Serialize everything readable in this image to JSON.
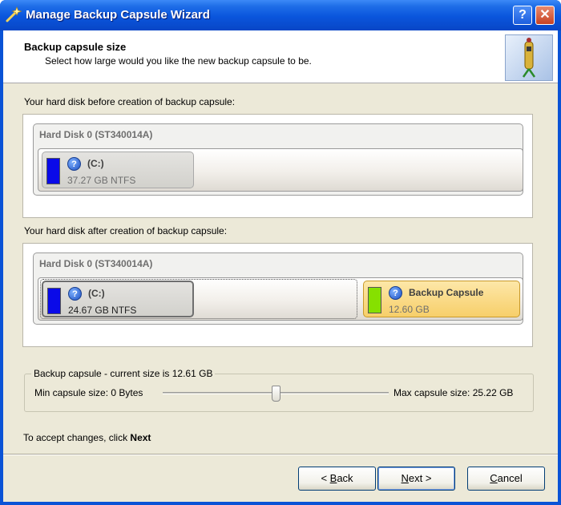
{
  "window": {
    "title": "Manage Backup Capsule Wizard",
    "help_glyph": "?",
    "close_glyph": "✕"
  },
  "header": {
    "title": "Backup capsule size",
    "subtitle": "Select how large would you like the new backup capsule to be."
  },
  "before": {
    "label": "Your hard disk before creation of backup capsule:",
    "disk_title": "Hard Disk 0 (ST340014A)",
    "partitions": [
      {
        "name": "(C:)",
        "size": "37.27 GB NTFS",
        "color": "#0a0ae8"
      }
    ]
  },
  "after": {
    "label": "Your hard disk after creation of backup capsule:",
    "disk_title": "Hard Disk 0 (ST340014A)",
    "partitions": [
      {
        "name": "(C:)",
        "size": "24.67 GB NTFS",
        "color": "#0a0ae8"
      },
      {
        "name": "Backup Capsule",
        "size": "12.60 GB",
        "color": "#86e000"
      }
    ]
  },
  "capsule": {
    "legend": "Backup capsule - current size is 12.61 GB",
    "min_label": "Min capsule size:",
    "min_value": "0 Bytes",
    "max_label": "Max capsule size:",
    "max_value": "25.22 GB",
    "slider_fraction": 0.5
  },
  "footer": {
    "accept_prefix": "To accept changes, click ",
    "accept_bold": "Next"
  },
  "buttons": {
    "back_mnemonic": "B",
    "back_rest": "ack",
    "back_arrow": "< ",
    "next_mnemonic": "N",
    "next_rest": "ext",
    "next_arrow": " >",
    "cancel_mnemonic": "C",
    "cancel_rest": "ancel"
  },
  "icons": {
    "partition_icon": "help-question-icon",
    "header_icon": "backup-capsule-icon"
  },
  "colors": {
    "titlebar": "#0a55dc",
    "capsule_highlight": "#fbd98b"
  }
}
